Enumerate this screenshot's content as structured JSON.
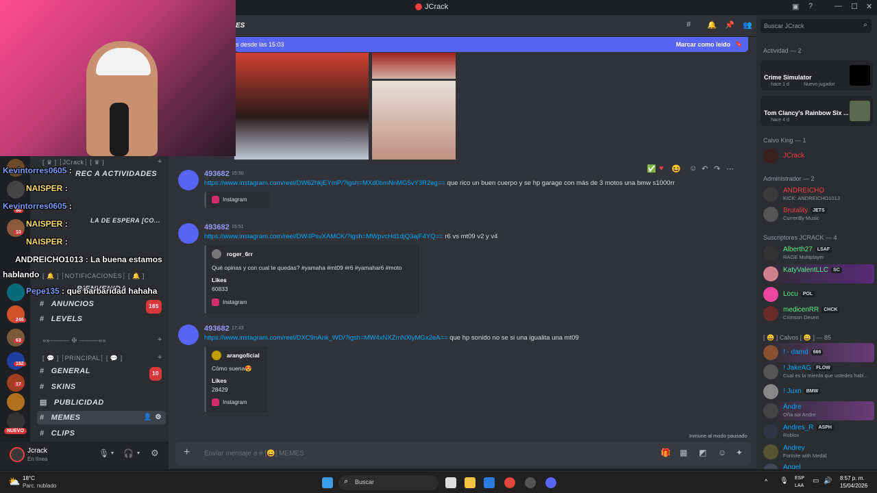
{
  "window": {
    "title": "JCrack"
  },
  "channel_header": {
    "title_fragment": "ES"
  },
  "new_messages_bar": {
    "text": "s desde las 15:03",
    "mark_read": "Marcar como leído"
  },
  "search": {
    "placeholder": "Buscar JCrack"
  },
  "overlay_chat": [
    {
      "user": "Kevintorres0605",
      "text": ":"
    },
    {
      "user": "NAISPER",
      "text": ":"
    },
    {
      "user": "Kevintorres0605",
      "text": ":"
    },
    {
      "user": "NAISPER",
      "text": ":"
    },
    {
      "user": "NAISPER",
      "text": ":"
    },
    {
      "user": "ANDREICHO1013",
      "text": ": La buena estamos"
    },
    {
      "user": "",
      "text": "hablando"
    },
    {
      "user": "Pepe135",
      "text": ": que barbaridad hahaha"
    }
  ],
  "sidebar": {
    "categories": {
      "jcrack": "[ ♛ ] ┆JCrack┆ [ ♛ ]",
      "notificaciones": "[ 🔔 ] ┆NOTIFICACIONES┆ [ 🔔 ]",
      "principal": "[ 💬 ] ┆PRINCIPAL┆ [ 💬 ]"
    },
    "partial_labels": {
      "actividades": "REC A ACTIVIDADES",
      "espera": "LA DE ESPERA [CO...",
      "bienvenida": "BIENVENIDA",
      "divider": "»»——— ✠ ———««"
    },
    "channels": [
      {
        "name": "ANUNCIOS",
        "badge": "165"
      },
      {
        "name": "LEVELS",
        "badge": ""
      },
      {
        "name": "GENERAL",
        "badge": "10"
      },
      {
        "name": "SKINS",
        "badge": ""
      },
      {
        "name": "PUBLICIDAD",
        "badge": ""
      },
      {
        "name": "MEMES",
        "badge": ""
      },
      {
        "name": "CLIPS",
        "badge": ""
      }
    ],
    "server_badges": [
      "88",
      "10",
      "246",
      "63",
      "152",
      "17"
    ],
    "new_label": "NUEVO"
  },
  "user": {
    "name": "Jcrack",
    "status": "En línea"
  },
  "messages": [
    {
      "author": "493682",
      "time": "15:30",
      "link": "https://www.instagram.com/reel/DW62hkjEYmP/?igsh=MXd0bmNnMG5vY3R2eg==",
      "text": "que rico un buen cuerpo y se hp garage con más de 3 motos una bmw s1000rr",
      "embed": {
        "provider": "Instagram"
      }
    },
    {
      "author": "493682",
      "time": "15:51",
      "link": "https://www.instagram.com/reel/DW4PsvXAMCK/?igsh=MWpvcHd1djQ3ajF4YQ==",
      "text": "r6 vs mt09 v2 y v4",
      "embed": {
        "account": "roger_6rr",
        "caption": "Qué opinas y con cual te quedas? #yamaha #mt09 #r6 #yamahar6 #moto",
        "likes_label": "Likes",
        "likes": "60833",
        "provider": "Instagram"
      }
    },
    {
      "author": "493682",
      "time": "17:43",
      "link": "https://www.instagram.com/reel/DXC9nAnk_WD/?igsh=MW4xNXZmNXlyMGx2eA==",
      "text": "que hp sonido no se si una igualita una mt09",
      "embed": {
        "account": "arangoficial",
        "caption": "Cómo suena😍",
        "likes_label": "Likes",
        "likes": "28429",
        "provider": "Instagram"
      }
    }
  ],
  "composer": {
    "placeholder": "Enviar mensaje a # [😄] MEMES",
    "immune": "Inmune al modo pausado"
  },
  "members": {
    "activity_header": "Actividad — 2",
    "activities": [
      {
        "title": "Crime Simulator",
        "meta": "hace 1 d",
        "extra": "Nuevo jugador"
      },
      {
        "title": "Tom Clancy's Rainbow Six ...",
        "meta": "hace 4 d",
        "extra": ""
      }
    ],
    "groups": [
      {
        "label": "Calvo King — 1",
        "members": [
          {
            "name": "JCrack",
            "sub": "",
            "tag": "",
            "color": "#f23f43"
          }
        ]
      },
      {
        "label": "Administrador — 2",
        "members": [
          {
            "name": "ANDREICHO",
            "sub": "KICK: ANDREICHO1013",
            "tag": "",
            "color": "#f23f43"
          },
          {
            "name": "Brutality",
            "sub": "Curren$y Music",
            "tag": "JETS",
            "color": "#f23f43"
          }
        ]
      },
      {
        "label": "Suscriptores JCRACK — 4",
        "members": [
          {
            "name": "Alberth27",
            "sub": "RAGE Multiplayer",
            "tag": "LSAF",
            "color": "#57f287"
          },
          {
            "name": "KatyValentLLC",
            "sub": "",
            "tag": "SC",
            "color": "#57f287"
          },
          {
            "name": "Locu",
            "sub": "",
            "tag": "POL",
            "color": "#57f287"
          },
          {
            "name": "medicenRR",
            "sub": "Crimson Desert",
            "tag": "CHCK",
            "color": "#57f287"
          }
        ]
      },
      {
        "label": "[ 😀 ] Calvos [ 😀 ] — 85",
        "members": [
          {
            "name": "! - damd",
            "sub": "",
            "tag": "666",
            "color": "#00a8fc"
          },
          {
            "name": "! JakeAG",
            "sub": "Cual es la mierda que ustedes habl...",
            "tag": "FLOW",
            "color": "#00a8fc"
          },
          {
            "name": "! Juxn",
            "sub": "",
            "tag": "BMW",
            "color": "#00a8fc"
          },
          {
            "name": "Andre",
            "sub": "Oña soi Andre",
            "tag": "",
            "color": "#00a8fc"
          },
          {
            "name": "Andres_R",
            "sub": "Roblox",
            "tag": "ASPH",
            "color": "#00a8fc"
          },
          {
            "name": "Andrey",
            "sub": "Fortnite with Medal",
            "tag": "",
            "color": "#00a8fc"
          },
          {
            "name": "Angel",
            "sub": "",
            "tag": "",
            "color": "#00a8fc"
          }
        ]
      }
    ]
  },
  "taskbar": {
    "weather_temp": "18°C",
    "weather_desc": "Parc. nublado",
    "search_label": "Buscar",
    "lang": "ESP",
    "lang2": "LAA",
    "time": "8:57 p. m.",
    "date": "15/04/2026"
  }
}
